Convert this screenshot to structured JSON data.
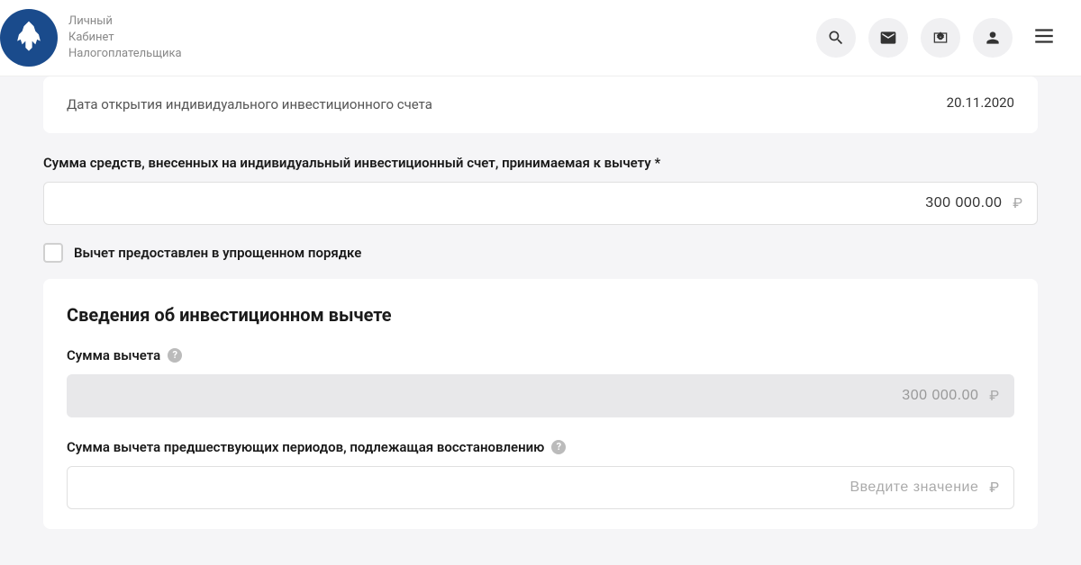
{
  "header": {
    "logo_text_line1": "Личный",
    "logo_text_line2": "Кабинет",
    "logo_text_line3": "Налогоплательщика"
  },
  "account": {
    "opening_date_label": "Дата открытия индивидуального инвестиционного счета",
    "opening_date_value": "20.11.2020",
    "deposit_label": "Сумма средств, внесенных на индивидуальный инвестиционный счет, принимаемая к вычету *",
    "deposit_value": "300 000.00",
    "simplified_checkbox_label": "Вычет предоставлен в упрощенном порядке"
  },
  "deduction": {
    "section_title": "Сведения об инвестиционном вычете",
    "amount_label": "Сумма вычета",
    "amount_value": "300 000.00",
    "prior_periods_label": "Сумма вычета предшествующих периодов, подлежащая восстановлению",
    "prior_periods_placeholder": "Введите значение"
  },
  "currency_symbol": "₽"
}
